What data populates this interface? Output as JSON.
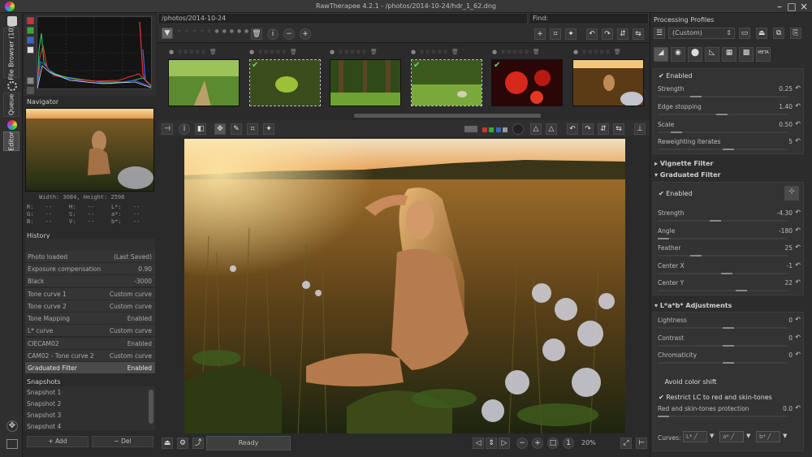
{
  "window": {
    "title": "RawTherapee 4.2.1 - /photos/2014-10-24/hdr_1_62.dng"
  },
  "left_tabs": [
    "File Browser (10)",
    "Queue",
    "Editor"
  ],
  "navigator": {
    "label": "Navigator",
    "size_text": "Width: 3084, Height: 2598",
    "readouts": [
      {
        "k": "R:",
        "v": "--"
      },
      {
        "k": "H:",
        "v": "--"
      },
      {
        "k": "L*:",
        "v": "--"
      },
      {
        "k": "G:",
        "v": "--"
      },
      {
        "k": "S:",
        "v": "--"
      },
      {
        "k": "a*:",
        "v": "--"
      },
      {
        "k": "B:",
        "v": "--"
      },
      {
        "k": "V:",
        "v": "--"
      },
      {
        "k": "b*:",
        "v": "--"
      }
    ]
  },
  "history": {
    "label": "History",
    "rows": [
      {
        "k": "Photo loaded",
        "v": "(Last Saved)"
      },
      {
        "k": "Exposure compensation",
        "v": "0.90"
      },
      {
        "k": "Black",
        "v": "-3000"
      },
      {
        "k": "Tone curve 1",
        "v": "Custom curve"
      },
      {
        "k": "Tone curve 2",
        "v": "Custom curve"
      },
      {
        "k": "Tone Mapping",
        "v": "Enabled"
      },
      {
        "k": "L* curve",
        "v": "Custom curve"
      },
      {
        "k": "CIECAM02",
        "v": "Enabled"
      },
      {
        "k": "CAM02 - Tone curve 2",
        "v": "Custom curve"
      },
      {
        "k": "Graduated Filter",
        "v": "Enabled"
      }
    ]
  },
  "snapshots": {
    "label": "Snapshots",
    "items": [
      "Snapshot 1",
      "Snapshot 2",
      "Snapshot 3",
      "Snapshot 4"
    ],
    "add_label": "Add",
    "del_label": "Del"
  },
  "filebrowser": {
    "path": "/photos/2014-10-24",
    "find_label": "Find:"
  },
  "status": {
    "text": "Ready",
    "zoom": "20%"
  },
  "right": {
    "profiles_label": "Processing Profiles",
    "profile_value": "(Custom)",
    "meta_tab": "META",
    "top_enabled": "Enabled",
    "top_params": [
      {
        "name": "Strength",
        "value": "0.25",
        "pos": 0.25
      },
      {
        "name": "Edge stopping",
        "value": "1.40",
        "pos": 0.45
      },
      {
        "name": "Scale",
        "value": "0.50",
        "pos": 0.1
      },
      {
        "name": "Reweighting iterates",
        "value": "5",
        "pos": 0.5
      }
    ],
    "vignette_label": "Vignette Filter",
    "graduated_label": "Graduated Filter",
    "grad_enabled": "Enabled",
    "grad_params": [
      {
        "name": "Strength",
        "value": "-4.30",
        "pos": 0.4
      },
      {
        "name": "Angle",
        "value": "-180",
        "pos": 0.0
      },
      {
        "name": "Feather",
        "value": "25",
        "pos": 0.25
      },
      {
        "name": "Center X",
        "value": "-1",
        "pos": 0.5
      },
      {
        "name": "Center Y",
        "value": "22",
        "pos": 0.6
      }
    ],
    "lab_label": "L*a*b* Adjustments",
    "lab_params": [
      {
        "name": "Lightness",
        "value": "0",
        "pos": 0.5
      },
      {
        "name": "Contrast",
        "value": "0",
        "pos": 0.5
      },
      {
        "name": "Chromaticity",
        "value": "0",
        "pos": 0.5
      }
    ],
    "avoid_color_shift": "Avoid color shift",
    "restrict_lc": "Restrict LC to red and skin-tones",
    "red_skin_label": "Red and skin-tones protection",
    "red_skin_value": "0.0",
    "curves_label": "Curves:",
    "curve_buttons": [
      "L*",
      "a*",
      "b*"
    ]
  },
  "colors": {
    "accent": "#6bd36b",
    "panel": "#2c2c2c",
    "bg": "#2a2a2a"
  }
}
